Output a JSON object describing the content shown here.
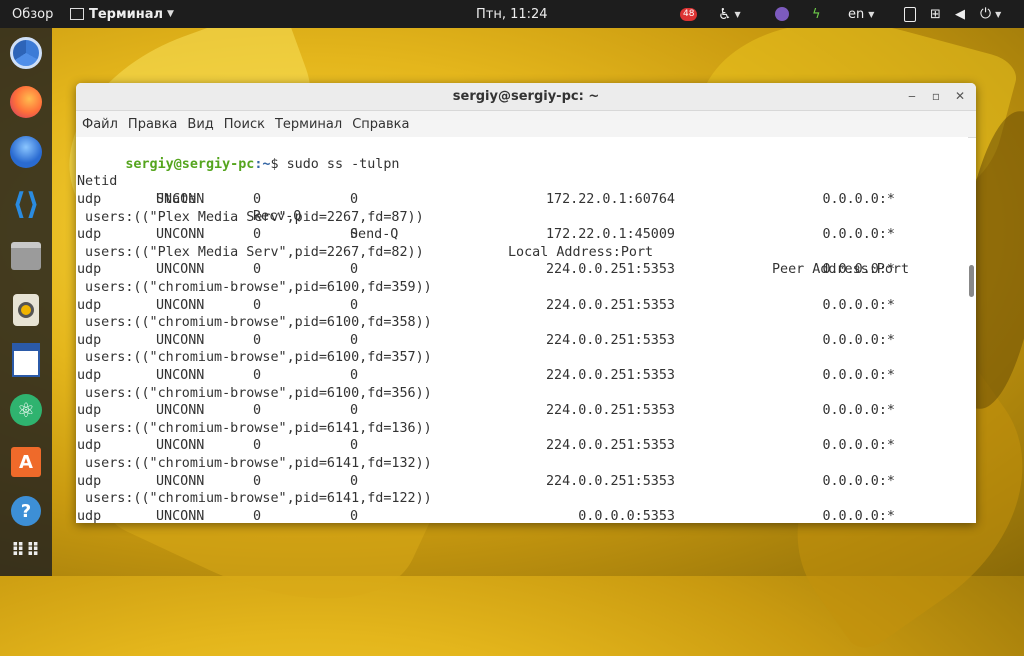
{
  "topbar": {
    "activities": "Обзор",
    "app_menu": "Терминал",
    "clock": "Птн, 11:24",
    "notifications_badge": "48",
    "language": "en"
  },
  "dock": {
    "icons": [
      "chromium-icon",
      "firefox-icon",
      "thunderbird-icon",
      "vscode-icon",
      "files-icon",
      "rhythmbox-icon",
      "libreoffice-writer-icon",
      "atom-icon",
      "software-center-icon",
      "help-icon",
      "app-grid-icon"
    ]
  },
  "window": {
    "title": "sergiy@sergiy-pc: ~",
    "menu": [
      "Файл",
      "Правка",
      "Вид",
      "Поиск",
      "Терминал",
      "Справка"
    ]
  },
  "terminal": {
    "prompt_user": "sergiy@sergiy-pc",
    "prompt_path": ":~",
    "prompt_symbol": "$ ",
    "command": "sudo ss -tulpn",
    "headers": {
      "netid": "Netid",
      "state": "State",
      "recvq": "Recv-Q",
      "sendq": "Send-Q",
      "local": "Local Address:Port",
      "peer": "Peer Address:Port"
    },
    "rows": [
      {
        "netid": "udp",
        "state": "UNCONN",
        "recvq": "0",
        "sendq": "0",
        "local": "172.22.0.1:60764",
        "peer": "0.0.0.0:*",
        "users": " users:((\"Plex Media Serv\",pid=2267,fd=87))"
      },
      {
        "netid": "udp",
        "state": "UNCONN",
        "recvq": "0",
        "sendq": "0",
        "local": "172.22.0.1:45009",
        "peer": "0.0.0.0:*",
        "users": " users:((\"Plex Media Serv\",pid=2267,fd=82))"
      },
      {
        "netid": "udp",
        "state": "UNCONN",
        "recvq": "0",
        "sendq": "0",
        "local": "224.0.0.251:5353",
        "peer": "0.0.0.0:*",
        "users": " users:((\"chromium-browse\",pid=6100,fd=359))"
      },
      {
        "netid": "udp",
        "state": "UNCONN",
        "recvq": "0",
        "sendq": "0",
        "local": "224.0.0.251:5353",
        "peer": "0.0.0.0:*",
        "users": " users:((\"chromium-browse\",pid=6100,fd=358))"
      },
      {
        "netid": "udp",
        "state": "UNCONN",
        "recvq": "0",
        "sendq": "0",
        "local": "224.0.0.251:5353",
        "peer": "0.0.0.0:*",
        "users": " users:((\"chromium-browse\",pid=6100,fd=357))"
      },
      {
        "netid": "udp",
        "state": "UNCONN",
        "recvq": "0",
        "sendq": "0",
        "local": "224.0.0.251:5353",
        "peer": "0.0.0.0:*",
        "users": " users:((\"chromium-browse\",pid=6100,fd=356))"
      },
      {
        "netid": "udp",
        "state": "UNCONN",
        "recvq": "0",
        "sendq": "0",
        "local": "224.0.0.251:5353",
        "peer": "0.0.0.0:*",
        "users": " users:((\"chromium-browse\",pid=6141,fd=136))"
      },
      {
        "netid": "udp",
        "state": "UNCONN",
        "recvq": "0",
        "sendq": "0",
        "local": "224.0.0.251:5353",
        "peer": "0.0.0.0:*",
        "users": " users:((\"chromium-browse\",pid=6141,fd=132))"
      },
      {
        "netid": "udp",
        "state": "UNCONN",
        "recvq": "0",
        "sendq": "0",
        "local": "224.0.0.251:5353",
        "peer": "0.0.0.0:*",
        "users": " users:((\"chromium-browse\",pid=6141,fd=122))"
      },
      {
        "netid": "udp",
        "state": "UNCONN",
        "recvq": "0",
        "sendq": "0",
        "local": "0.0.0.0:5353",
        "peer": "0.0.0.0:*",
        "users": ""
      }
    ]
  },
  "colors": {
    "prompt_user": "#55a51e",
    "prompt_path": "#3465a4",
    "topbar": "#1d1d1d"
  }
}
